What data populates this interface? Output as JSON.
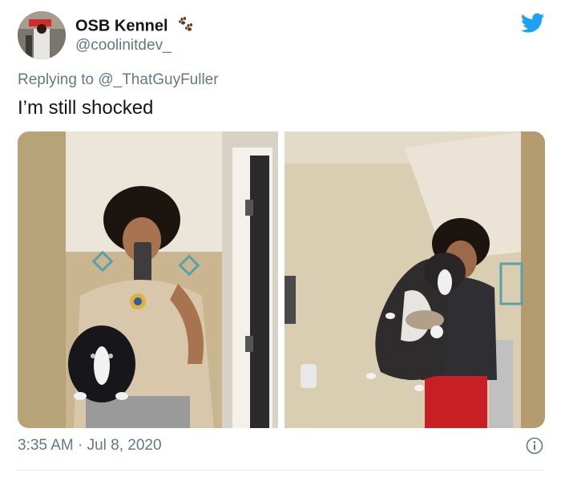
{
  "tweet": {
    "display_name": "OSB Kennel",
    "handle": "@coolinitdev_",
    "reply_prefix": "Replying to",
    "reply_mention": "@_ThatGuyFuller",
    "text": "I’m still shocked",
    "timestamp": "3:35 AM · Jul 8, 2020"
  },
  "icons": {
    "paws": "paw-prints-emoji",
    "brand": "twitter-bird-icon",
    "info": "info-icon"
  },
  "colors": {
    "twitter_blue": "#1da1f2",
    "secondary_text": "#657786",
    "primary_text": "#14171a"
  }
}
